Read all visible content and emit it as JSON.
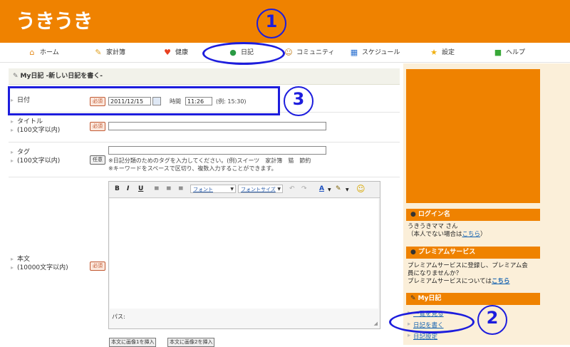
{
  "header": {
    "logo": "うきうき"
  },
  "nav": {
    "items": [
      {
        "label": "ホーム",
        "icon": "home-icon",
        "glyph": "⌂",
        "color": "#e48a1a"
      },
      {
        "label": "家計簿",
        "icon": "pencil-icon",
        "glyph": "✎",
        "color": "#e0a020"
      },
      {
        "label": "健康",
        "icon": "heart-icon",
        "glyph": "♥",
        "color": "#e84020"
      },
      {
        "label": "日記",
        "icon": "person-icon",
        "glyph": "●",
        "color": "#2a9a44"
      },
      {
        "label": "コミュニティ",
        "icon": "community-icon",
        "glyph": "☺",
        "color": "#c08020"
      },
      {
        "label": "スケジュール",
        "icon": "calendar-icon",
        "glyph": "▦",
        "color": "#2a70d0"
      },
      {
        "label": "設定",
        "icon": "star-icon",
        "glyph": "★",
        "color": "#f0b010"
      },
      {
        "label": "ヘルプ",
        "icon": "help-icon",
        "glyph": "■",
        "color": "#38a838"
      }
    ]
  },
  "markers": {
    "m1": "1",
    "m2": "2",
    "m3": "3"
  },
  "section": {
    "title": "My日記 -新しい日記を書く-"
  },
  "form": {
    "date": {
      "label": "日付",
      "badge": "必須",
      "value": "2011/12/15",
      "time_label": "時間",
      "time_value": "11:26",
      "example": "(例: 15:30)"
    },
    "title": {
      "label": "タイトル",
      "sub": "(100文字以内)",
      "badge": "必須",
      "value": ""
    },
    "tag": {
      "label": "タグ",
      "sub": "(100文字以内)",
      "badge": "任意",
      "value": "",
      "help1": "※日記分類のためのタグを入力してください。(例)スイーツ　家計簿　猫　節約",
      "help2": "※キーワードをスペースで区切り、複数入力することができます。"
    },
    "body": {
      "label": "本文",
      "sub": "(10000文字以内)",
      "badge": "必須",
      "path_label": "パス:",
      "toolbar": {
        "bold": "B",
        "italic": "I",
        "underline": "U",
        "font": "フォント",
        "font_size": "フォントサイズ"
      },
      "img_btn1": "本文に画像1を挿入",
      "img_btn2": "本文に画像2を挿入"
    }
  },
  "sidebar": {
    "login": {
      "title": "ログイン名",
      "name": "うきうきママ さん",
      "note_prefix": "（本人でない場合は",
      "note_link": "こちら",
      "note_suffix": "）"
    },
    "premium": {
      "title": "プレミアムサービス",
      "text1": "プレミアムサービスに登録し、プレミアム会",
      "text2": "員になりませんか？",
      "text3_prefix": "プレミアムサービスについては",
      "text3_link": "こちら"
    },
    "diary": {
      "title": "My日記",
      "links": [
        "一覧を見る",
        "日記を書く",
        "日記設定"
      ]
    }
  }
}
